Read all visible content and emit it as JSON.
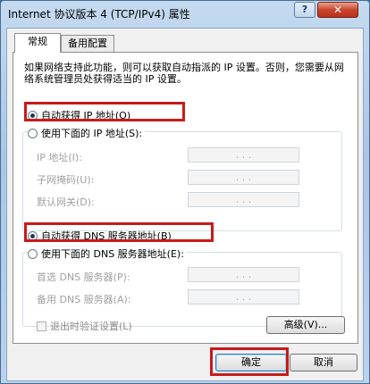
{
  "window": {
    "title": "Internet 协议版本 4 (TCP/IPv4) 属性",
    "help_label": "?",
    "close_label": "✕"
  },
  "tabs": [
    {
      "label": "常规",
      "active": true
    },
    {
      "label": "备用配置",
      "active": false
    }
  ],
  "description": "如果网络支持此功能，则可以获取自动指派的 IP 设置。否则，您需要从网络系统管理员处获得适当的 IP 设置。",
  "ip_section": {
    "auto_label": "自动获得 IP 地址(O)",
    "auto_selected": true,
    "manual_label": "使用下面的 IP 地址(S):",
    "manual_selected": false,
    "fields": [
      {
        "label": "IP 地址(I):",
        "value": ". . ."
      },
      {
        "label": "子网掩码(U):",
        "value": ". . ."
      },
      {
        "label": "默认网关(D):",
        "value": ". . ."
      }
    ]
  },
  "dns_section": {
    "auto_label": "自动获得 DNS 服务器地址(B)",
    "auto_selected": true,
    "manual_label": "使用下面的 DNS 服务器地址(E):",
    "manual_selected": false,
    "fields": [
      {
        "label": "首选 DNS 服务器(P):",
        "value": ". . ."
      },
      {
        "label": "备用 DNS 服务器(A):",
        "value": ". . ."
      }
    ]
  },
  "validate_on_exit_label": "退出时验证设置(L)",
  "validate_on_exit_checked": false,
  "buttons": {
    "advanced": "高级(V)...",
    "ok": "确定",
    "cancel": "取消"
  },
  "highlight_color": "#c81a1a"
}
